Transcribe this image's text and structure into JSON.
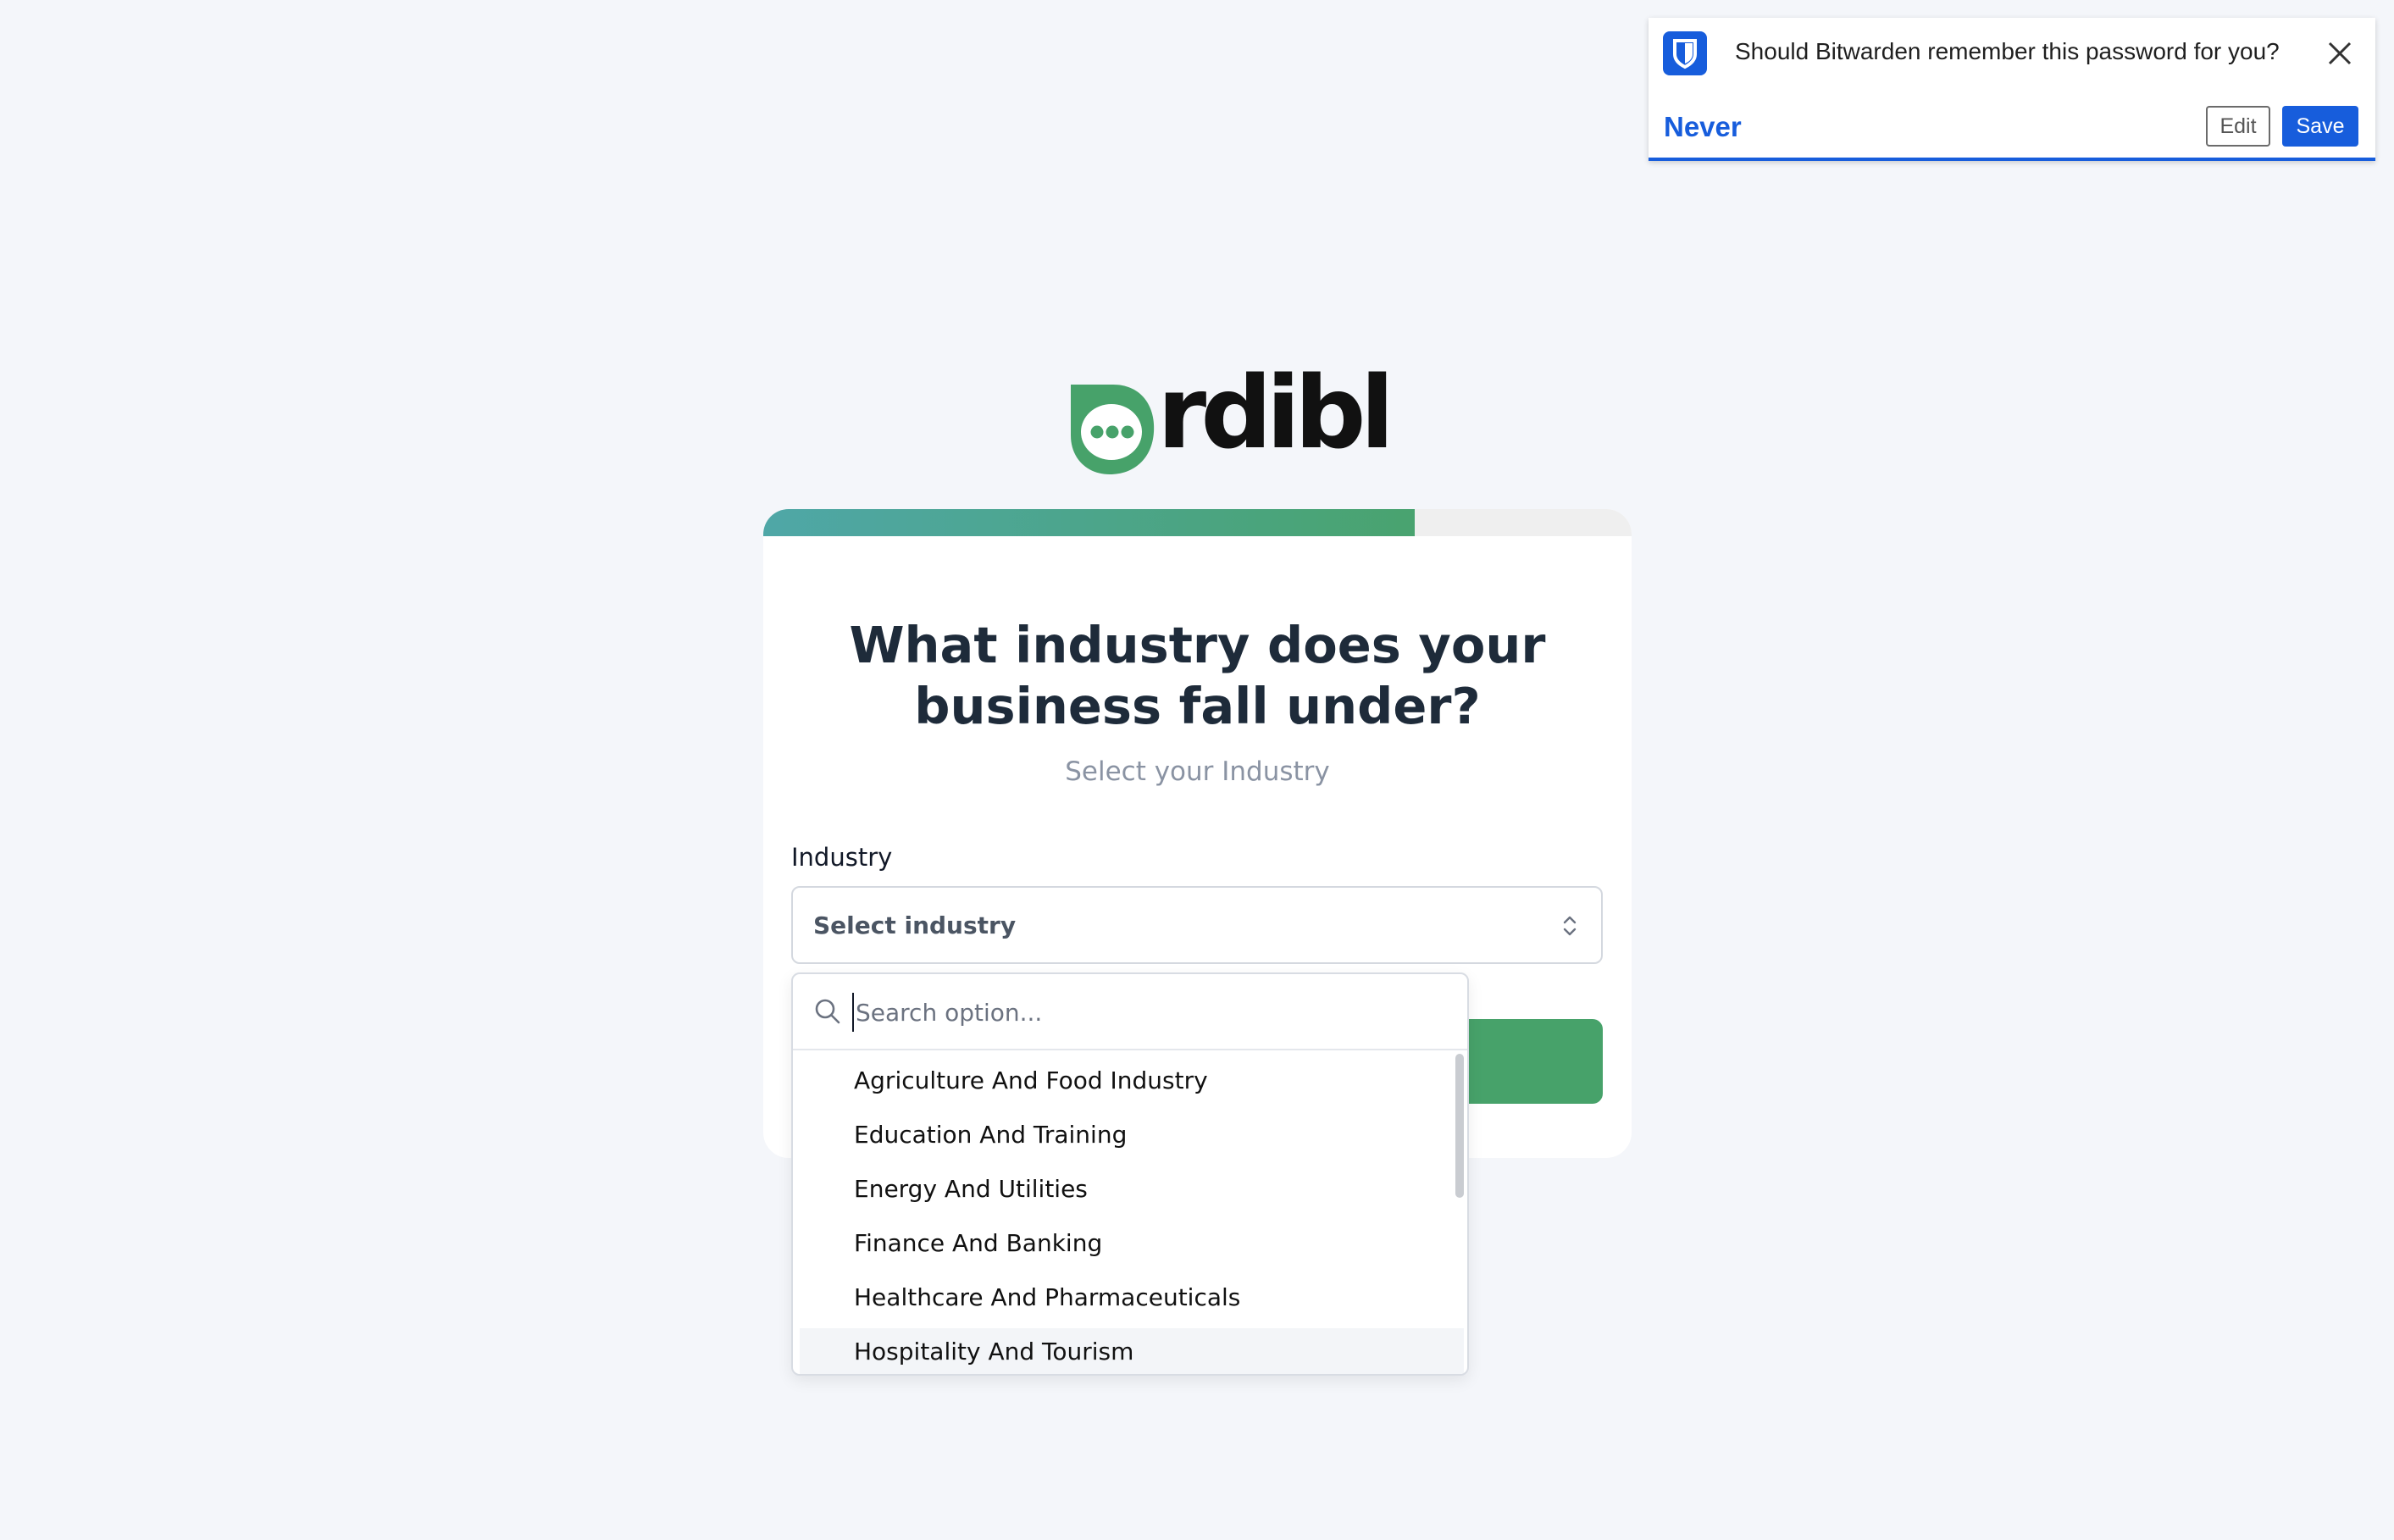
{
  "bitwarden": {
    "message": "Should Bitwarden remember this password for you?",
    "never_label": "Never",
    "edit_label": "Edit",
    "save_label": "Save",
    "accent_color": "#175ddc"
  },
  "logo": {
    "text": "rdibl",
    "icon": "speech-bubble-dots-icon",
    "color": "#47a26a"
  },
  "progress": {
    "fraction": 0.75,
    "colors": [
      "#4fa7a7",
      "#49a36f"
    ]
  },
  "form": {
    "heading_line1": "What industry does your",
    "heading_line2": "business fall under?",
    "subheading": "Select your Industry",
    "field_label": "Industry",
    "select_value": "Select industry",
    "button_color": "#47a26a"
  },
  "dropdown": {
    "search_placeholder": "Search option...",
    "options": [
      "Agriculture And Food Industry",
      "Education And Training",
      "Energy And Utilities",
      "Finance And Banking",
      "Healthcare And Pharmaceuticals",
      "Hospitality And Tourism"
    ],
    "highlighted_option": "Hospitality And Tourism"
  }
}
